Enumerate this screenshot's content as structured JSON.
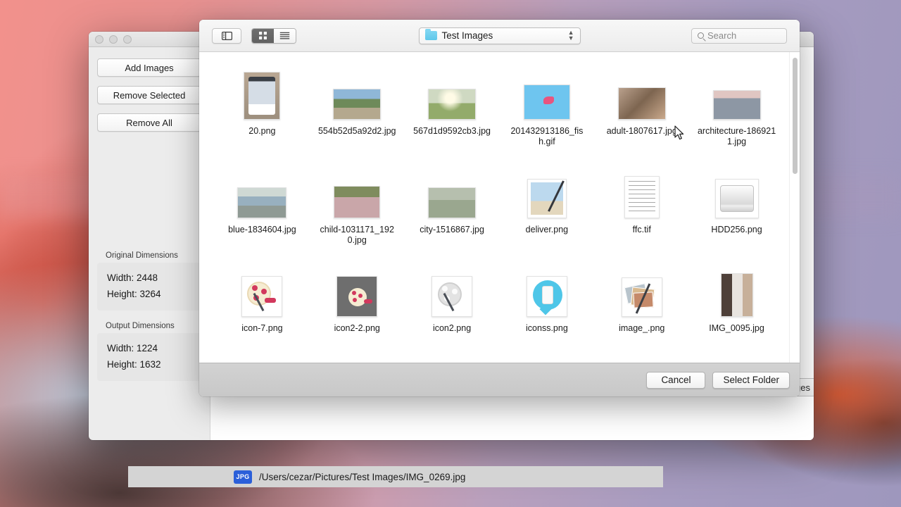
{
  "desktop": {
    "wallpaper_name": "macos-sierra-mountain"
  },
  "app_window": {
    "traffic_lights": [
      "close",
      "minimize",
      "zoom"
    ],
    "buttons": [
      {
        "label": "Add Images",
        "name": "add-images-button"
      },
      {
        "label": "Remove Selected",
        "name": "remove-selected-button"
      },
      {
        "label": "Remove All",
        "name": "remove-all-button"
      }
    ],
    "original_dimensions": {
      "title": "Original Dimensions",
      "width_label": "Width: 2448",
      "height_label": "Height: 3264"
    },
    "output_dimensions": {
      "title": "Output Dimensions",
      "width_label": "Width: 1224",
      "height_label": "Height: 1632"
    },
    "resize_button_label": "Resize Images",
    "file_path_row": {
      "badge": "JPG",
      "path": "/Users/cezar/Pictures/Test Images/IMG_0269.jpg"
    }
  },
  "sheet": {
    "toolbar": {
      "sidebar_toggle_icon": "sidebar-icon",
      "view_modes": [
        {
          "label": "icon-view",
          "selected": true
        },
        {
          "label": "list-view",
          "selected": false
        }
      ],
      "folder_popup": {
        "icon": "folder-icon",
        "name": "Test Images",
        "stepper": "updown-chevrons"
      },
      "search": {
        "icon": "search-icon",
        "placeholder": "Search",
        "value": ""
      }
    },
    "files": [
      {
        "name": "20.png",
        "kind": "image-portrait",
        "thumb": "phone-ui"
      },
      {
        "name": "554b52d5a92d2.jpg",
        "kind": "image-landscape",
        "thumb": "mountain-road"
      },
      {
        "name": "567d1d9592cb3.jpg",
        "kind": "image-landscape",
        "thumb": "sunlit-trees"
      },
      {
        "name": "201432913186_fish.gif",
        "kind": "image-landscape",
        "thumb": "blue-fish"
      },
      {
        "name": "adult-1807617.jpg",
        "kind": "image-landscape",
        "thumb": "vintage-interior"
      },
      {
        "name": "architecture-1869211.jpg",
        "kind": "image-landscape",
        "thumb": "city-skyline"
      },
      {
        "name": "blue-1834604.jpg",
        "kind": "image-landscape",
        "thumb": "blue-car"
      },
      {
        "name": "child-1031171_1920.jpg",
        "kind": "image-landscape",
        "thumb": "child-field"
      },
      {
        "name": "city-1516867.jpg",
        "kind": "image-landscape",
        "thumb": "aerial-city"
      },
      {
        "name": "deliver.png",
        "kind": "icon",
        "thumb": "photo-pencil"
      },
      {
        "name": "ffc.tif",
        "kind": "document",
        "thumb": "text-page"
      },
      {
        "name": "HDD256.png",
        "kind": "icon",
        "thumb": "hard-drive"
      },
      {
        "name": "icon-7.png",
        "kind": "icon",
        "thumb": "film-reel-light"
      },
      {
        "name": "icon2-2.png",
        "kind": "icon",
        "thumb": "film-reel-dark"
      },
      {
        "name": "icon2.png",
        "kind": "icon",
        "thumb": "film-reel-grey"
      },
      {
        "name": "iconss.png",
        "kind": "icon",
        "thumb": "phone-bubble"
      },
      {
        "name": "image_.png",
        "kind": "icon",
        "thumb": "photos-pencil"
      },
      {
        "name": "IMG_0095.jpg",
        "kind": "image-portrait",
        "thumb": "room-interior"
      }
    ],
    "footer": {
      "cancel_label": "Cancel",
      "select_label": "Select Folder"
    },
    "scrollbar": {
      "visible": true
    }
  }
}
